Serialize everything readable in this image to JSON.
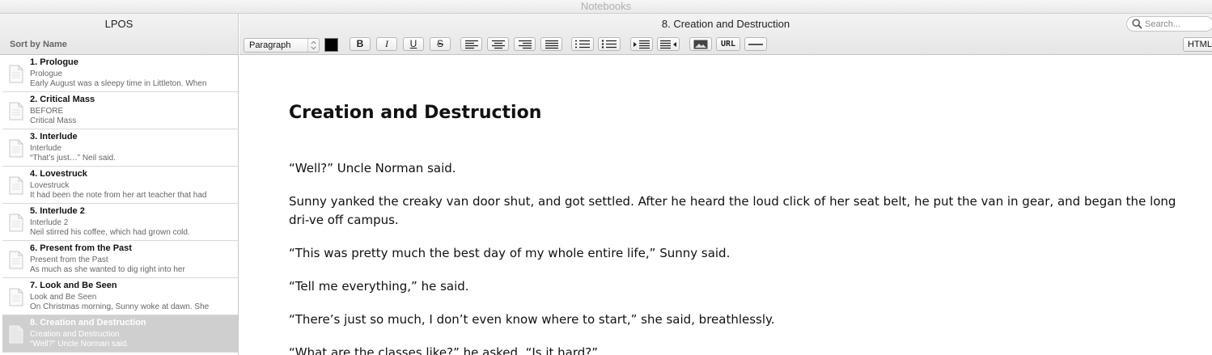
{
  "window": {
    "title": "Notebooks"
  },
  "sidebar": {
    "title": "LPOS",
    "sort_label": "Sort by Name",
    "notes": [
      {
        "title": "1. Prologue",
        "subtitle": "Prologue",
        "snippet": "Early August was a sleepy time in Littleton.  When"
      },
      {
        "title": "2. Critical Mass",
        "subtitle": "BEFORE",
        "snippet": "Critical Mass"
      },
      {
        "title": "3. Interlude",
        "subtitle": "Interlude",
        "snippet": "“That’s just…” Neil said."
      },
      {
        "title": "4. Lovestruck",
        "subtitle": "Lovestruck",
        "snippet": "It had been the note from her art teacher that had"
      },
      {
        "title": "5. Interlude 2",
        "subtitle": "Interlude 2",
        "snippet": "Neil stirred his coffee, which had grown cold."
      },
      {
        "title": "6. Present from the Past",
        "subtitle": "Present from the Past",
        "snippet": "As much as she wanted to dig right into her"
      },
      {
        "title": "7. Look and Be Seen",
        "subtitle": "Look and Be Seen",
        "snippet": "On Christmas morning, Sunny woke at dawn.  She"
      },
      {
        "title": "8. Creation and Destruction",
        "subtitle": "Creation and Destruction",
        "snippet": "“Well?” Uncle Norman said."
      }
    ]
  },
  "editor": {
    "doc_title": "8. Creation and Destruction",
    "search": {
      "placeholder": "Search..."
    },
    "toolbar": {
      "paragraph_style": "Paragraph",
      "bold": "B",
      "italic": "I",
      "underline": "U",
      "strike": "S",
      "url": "URL",
      "html": "HTML",
      "text_color": "#000000"
    },
    "content": {
      "heading": "Creation and Destruction",
      "paragraphs": [
        "“Well?” Uncle Norman said.",
        "Sunny yanked the creaky van door shut, and got settled.   After he heard the loud click of her seat belt, he put the van in gear, and began the long dri-ve off campus.",
        "“This was pretty much the best day of my whole entire life,” Sunny said.",
        "“Tell me everything,” he said.",
        "“There’s just so much, I don’t even know where to start,” she said, breathlessly.",
        "“What are the classes like?” he asked.  “Is it hard?”"
      ]
    }
  },
  "colors": {
    "selected_row": "#cfcfcf",
    "header_bg": "#e9e9e9",
    "border": "#c4c4c4"
  }
}
